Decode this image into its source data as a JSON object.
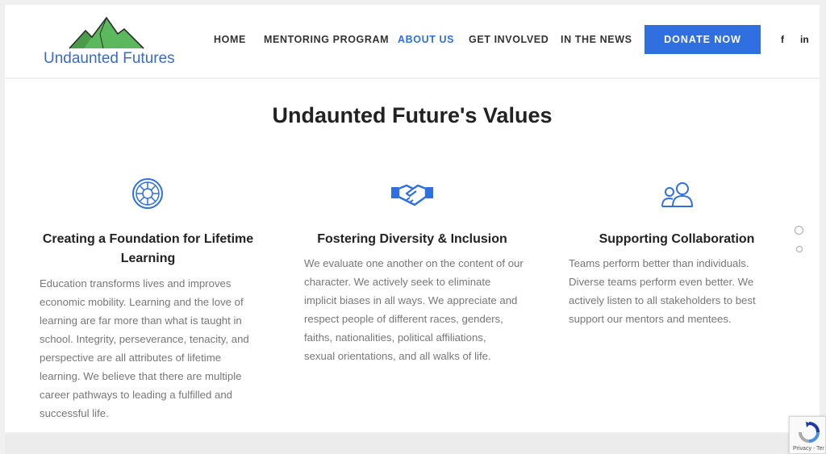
{
  "header": {
    "logo_text": "Undaunted Futures",
    "nav": [
      {
        "label": "HOME",
        "active": false
      },
      {
        "label": "MENTORING PROGRAM",
        "active": false
      },
      {
        "label": "ABOUT US",
        "active": true
      },
      {
        "label": "GET INVOLVED",
        "active": false
      },
      {
        "label": "IN THE NEWS",
        "active": false
      }
    ],
    "donate_label": "DONATE NOW",
    "social": [
      {
        "icon": "facebook-icon",
        "glyph": "f"
      },
      {
        "icon": "linkedin-icon",
        "glyph": "in"
      }
    ]
  },
  "main": {
    "title": "Undaunted Future's Values",
    "cards": [
      {
        "icon": "life-ring-icon",
        "title_line1": "Creating a Foundation for Lifetime",
        "title_line2": "Learning",
        "body": [
          "Education transforms lives and improves",
          "economic mobility. Learning and the love of",
          "learning are far more than what is taught in",
          "school. Integrity, perseverance, tenacity, and",
          "perspective are all attributes of lifetime",
          "learning. We believe that there are multiple",
          "career pathways to leading a fulfilled and",
          "successful life."
        ]
      },
      {
        "icon": "handshake-icon",
        "title_line1": "Fostering Diversity & Inclusion",
        "body": [
          "We evaluate one another on the content of our",
          "character. We actively seek to eliminate",
          "implicit biases in all ways. We appreciate and",
          "respect people of different races, genders,",
          "faiths, nationalities, political affiliations,",
          "sexual orientations, and all walks of life."
        ]
      },
      {
        "icon": "users-icon",
        "title_line1": "Supporting Collaboration",
        "body": [
          "Teams perform better than individuals.",
          "Diverse teams perform even better. We",
          "actively listen to all stakeholders to best",
          "support our mentors and mentees."
        ]
      }
    ]
  },
  "recaptcha": {
    "text": "Privacy - Ter"
  },
  "colors": {
    "accent": "#2f6fe0",
    "logo_green": "#5cb85c",
    "logo_text": "#3a6bc4"
  }
}
